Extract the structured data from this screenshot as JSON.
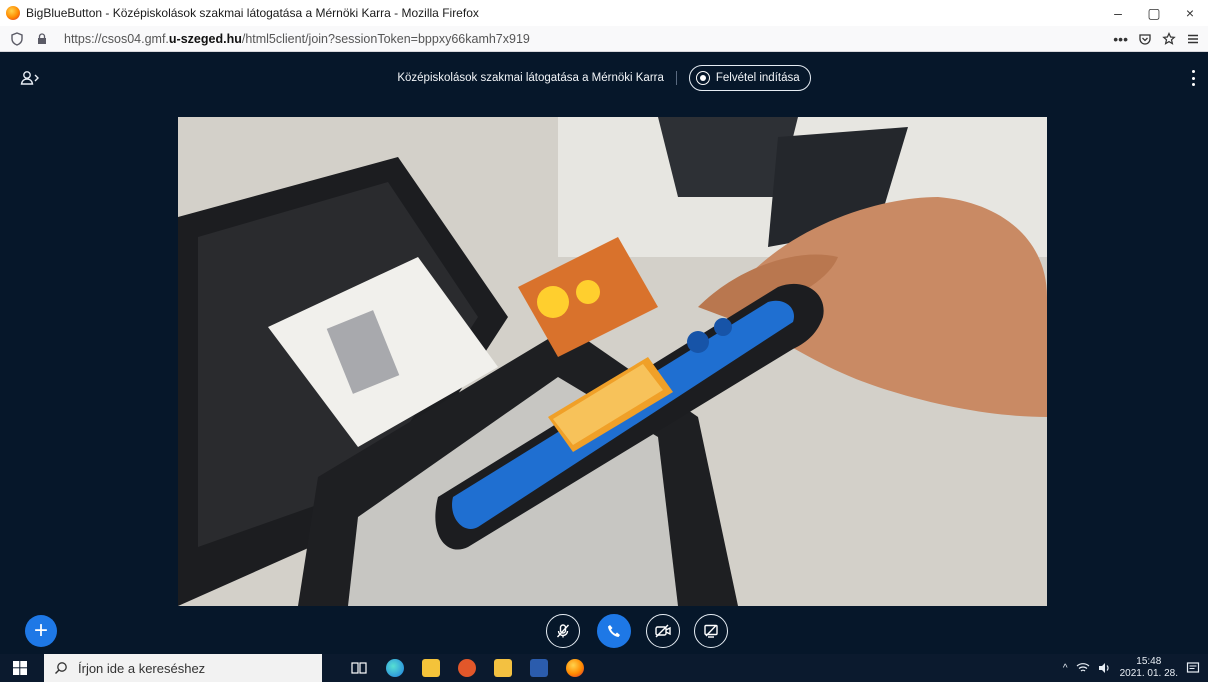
{
  "window": {
    "title": "BigBlueButton - Középiskolások szakmai látogatása a Mérnöki Karra - Mozilla Firefox",
    "min": "–",
    "max": "▢",
    "close": "×"
  },
  "address": {
    "url_prefix": "https://csos04.gmf.",
    "url_host": "u-szeged.hu",
    "url_suffix": "/html5client/join?sessionToken=bppxy66kamh7x919",
    "more": "•••"
  },
  "meeting": {
    "title": "Középiskolások szakmai látogatása a Mérnöki Karra",
    "record_label": "Felvétel indítása"
  },
  "actions": {
    "plus_label": "+"
  },
  "taskbar": {
    "search_placeholder": "Írjon ide a kereséshez",
    "time": "15:48",
    "date": "2021. 01. 28."
  },
  "colors": {
    "bbb_bg": "#06172a",
    "accent": "#1e78e6"
  }
}
